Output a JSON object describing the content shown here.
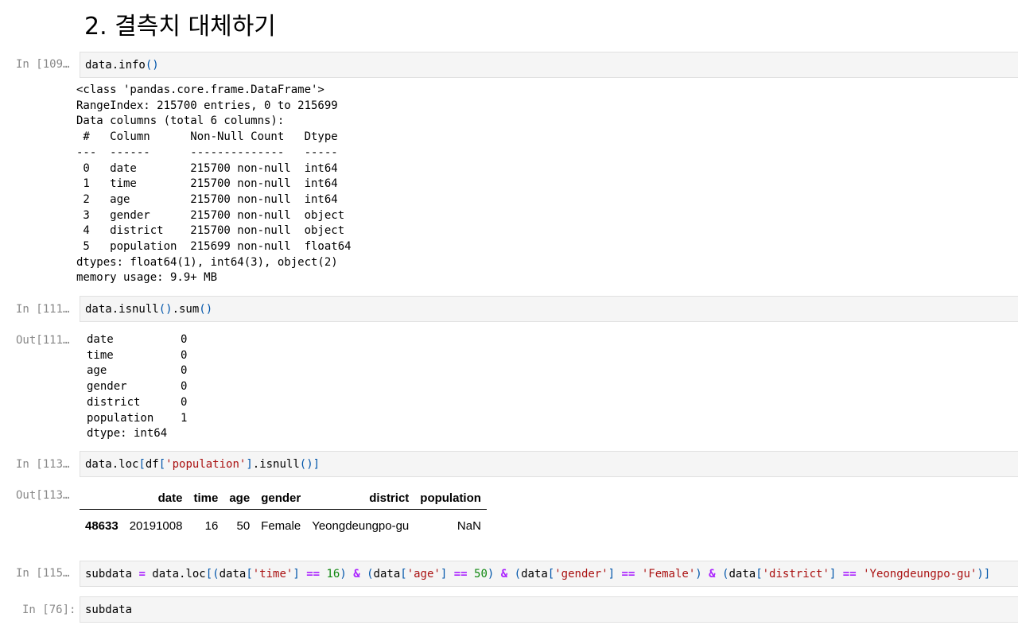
{
  "heading": "2. 결측치 대체하기",
  "cells": [
    {
      "prompt": "In [109…",
      "code": "data.info()"
    },
    {
      "prompt": "In [111…",
      "code": "data.isnull().sum()",
      "out_prompt": "Out[111…"
    },
    {
      "prompt": "In [113…",
      "code": "data.loc[df['population'].isnull()]",
      "out_prompt": "Out[113…"
    },
    {
      "prompt": "In [115…",
      "code": "subdata = data.loc[(data['time'] == 16) & (data['age'] == 50) & (data['gender'] == 'Female') & (data['district'] == 'Yeongdeungpo-gu')]"
    },
    {
      "prompt": "In [76]:",
      "code": "subdata"
    }
  ],
  "info_output": [
    "<class 'pandas.core.frame.DataFrame'>",
    "RangeIndex: 215700 entries, 0 to 215699",
    "Data columns (total 6 columns):",
    " #   Column      Non-Null Count   Dtype  ",
    "---  ------      --------------   -----  ",
    " 0   date        215700 non-null  int64  ",
    " 1   time        215700 non-null  int64  ",
    " 2   age         215700 non-null  int64  ",
    " 3   gender      215700 non-null  object ",
    " 4   district    215700 non-null  object ",
    " 5   population  215699 non-null  float64",
    "dtypes: float64(1), int64(3), object(2)",
    "memory usage: 9.9+ MB"
  ],
  "isnull_output": [
    "date          0",
    "time          0",
    "age           0",
    "gender        0",
    "district      0",
    "population    1",
    "dtype: int64"
  ],
  "dataframe": {
    "columns": [
      "",
      "date",
      "time",
      "age",
      "gender",
      "district",
      "population"
    ],
    "rows": [
      [
        "48633",
        "20191008",
        "16",
        "50",
        "Female",
        "Yeongdeungpo-gu",
        "NaN"
      ]
    ]
  }
}
